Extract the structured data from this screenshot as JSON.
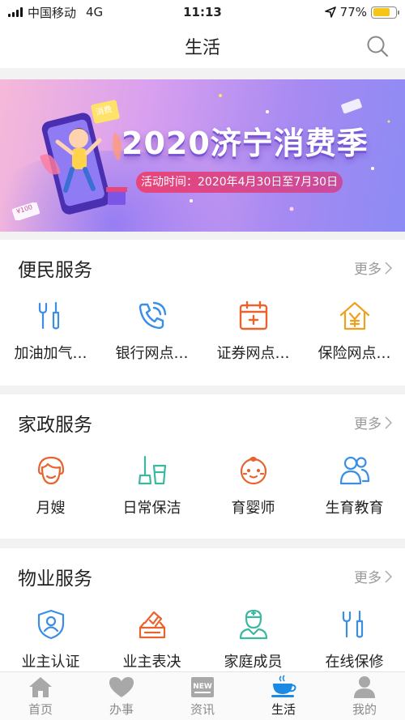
{
  "status": {
    "carrier": "中国移动",
    "network": "4G",
    "time": "11:13",
    "battery": "77%",
    "battery_level": 0.77
  },
  "nav": {
    "title": "生活",
    "search_icon": "search-icon"
  },
  "banner": {
    "headline": "2020济宁消费季",
    "period": "活动时间：2020年4月30日至7月30日",
    "deco_labels": [
      "消费",
      "¥100"
    ]
  },
  "sections": [
    {
      "title": "便民服务",
      "more": "更多",
      "items": [
        {
          "label": "加油加气…",
          "icon": "wrench-screwdriver-icon",
          "color": "#3a8ee6"
        },
        {
          "label": "银行网点…",
          "icon": "phone-icon",
          "color": "#3a8ee6"
        },
        {
          "label": "证券网点…",
          "icon": "calendar-icon",
          "color": "#e8632e"
        },
        {
          "label": "保险网点…",
          "icon": "yuan-house-icon",
          "color": "#f0a020"
        }
      ]
    },
    {
      "title": "家政服务",
      "more": "更多",
      "items": [
        {
          "label": "月嫂",
          "icon": "nanny-face-icon",
          "color": "#e8632e"
        },
        {
          "label": "日常保洁",
          "icon": "broom-bucket-icon",
          "color": "#3cb8a0"
        },
        {
          "label": "育婴师",
          "icon": "baby-face-icon",
          "color": "#e8632e"
        },
        {
          "label": "生育教育",
          "icon": "parent-child-icon",
          "color": "#3a8ee6"
        }
      ]
    },
    {
      "title": "物业服务",
      "more": "更多",
      "items": [
        {
          "label": "业主认证",
          "icon": "shield-user-icon",
          "color": "#3a8ee6"
        },
        {
          "label": "业主表决",
          "icon": "ballot-box-icon",
          "color": "#e8632e"
        },
        {
          "label": "家庭成员",
          "icon": "nurse-icon",
          "color": "#3cb8a0"
        },
        {
          "label": "在线保修",
          "icon": "wrench-screwdriver-icon",
          "color": "#3a8ee6"
        }
      ]
    }
  ],
  "tabs": [
    {
      "label": "首页",
      "icon": "home-icon",
      "active": false
    },
    {
      "label": "办事",
      "icon": "heart-icon",
      "active": false
    },
    {
      "label": "资讯",
      "icon": "news-icon",
      "active": false
    },
    {
      "label": "生活",
      "icon": "coffee-cup-icon",
      "active": true
    },
    {
      "label": "我的",
      "icon": "user-icon",
      "active": false
    }
  ],
  "colors": {
    "accent_blue": "#3a8ee6",
    "accent_orange": "#e8632e",
    "accent_teal": "#3cb8a0",
    "tab_active": "#1a8ae5"
  }
}
